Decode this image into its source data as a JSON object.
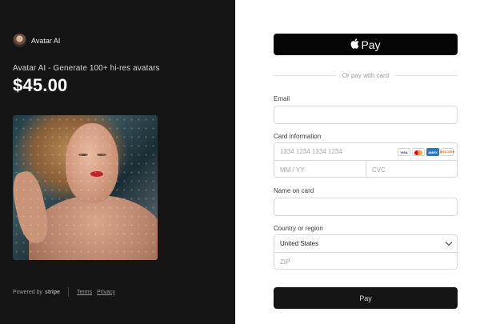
{
  "merchant": {
    "name": "Avatar AI",
    "product": "Avatar AI - Generate 100+ hi-res avatars",
    "price": "$45.00"
  },
  "footer": {
    "powered_by": "Powered by",
    "stripe": "stripe",
    "terms": "Terms",
    "privacy": "Privacy"
  },
  "payment": {
    "apple_pay_label": "Pay",
    "apple_icon": "apple-icon",
    "divider_text": "Or pay with card",
    "email_label": "Email",
    "email_value": "",
    "card_label": "Card information",
    "card_number_placeholder": "1234 1234 1234 1234",
    "card_brands": [
      "VISA",
      "mastercard",
      "AMEX",
      "DISCOVER"
    ],
    "expiry_placeholder": "MM / YY",
    "cvc_placeholder": "CVC",
    "name_label": "Name on card",
    "name_value": "",
    "country_label": "Country or region",
    "country_selected": "United States",
    "zip_placeholder": "ZIP",
    "pay_button_label": "Pay"
  },
  "colors": {
    "left_panel": "#151515",
    "apple_pay_button": "#050505",
    "pay_button": "#141414",
    "border": "#d9d9d9"
  }
}
